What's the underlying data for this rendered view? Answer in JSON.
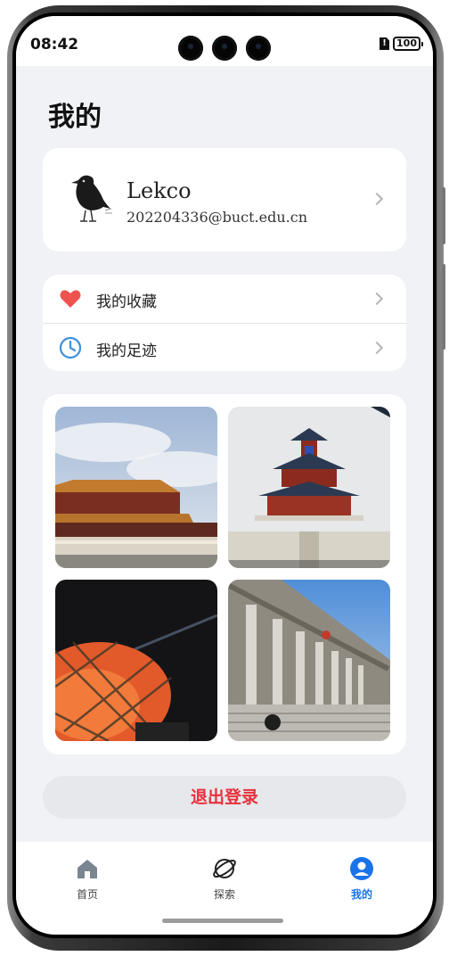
{
  "status_bar": {
    "time": "08:42",
    "sim_badge": "!",
    "battery": "100"
  },
  "page": {
    "title": "我的"
  },
  "profile": {
    "name": "Lekco",
    "email": "202204336@buct.edu.cn",
    "avatar_icon": "crow-avatar-icon"
  },
  "menu": {
    "items": [
      {
        "label": "我的收藏",
        "icon": "heart-icon",
        "color": "#ef5350"
      },
      {
        "label": "我的足迹",
        "icon": "clock-icon",
        "color": "#3d8fe0"
      }
    ]
  },
  "gallery": {
    "photos": [
      {
        "name": "forbidden-city-photo"
      },
      {
        "name": "temple-of-heaven-photo"
      },
      {
        "name": "birds-nest-photo"
      },
      {
        "name": "great-hall-photo"
      }
    ]
  },
  "logout": {
    "label": "退出登录",
    "color": "#e8303c"
  },
  "tabs": [
    {
      "label": "首页",
      "icon": "home-icon",
      "active": false
    },
    {
      "label": "探索",
      "icon": "planet-icon",
      "active": false
    },
    {
      "label": "我的",
      "icon": "profile-icon",
      "active": true
    }
  ],
  "colors": {
    "accent": "#1a73e8",
    "background": "#f1f2f6"
  }
}
